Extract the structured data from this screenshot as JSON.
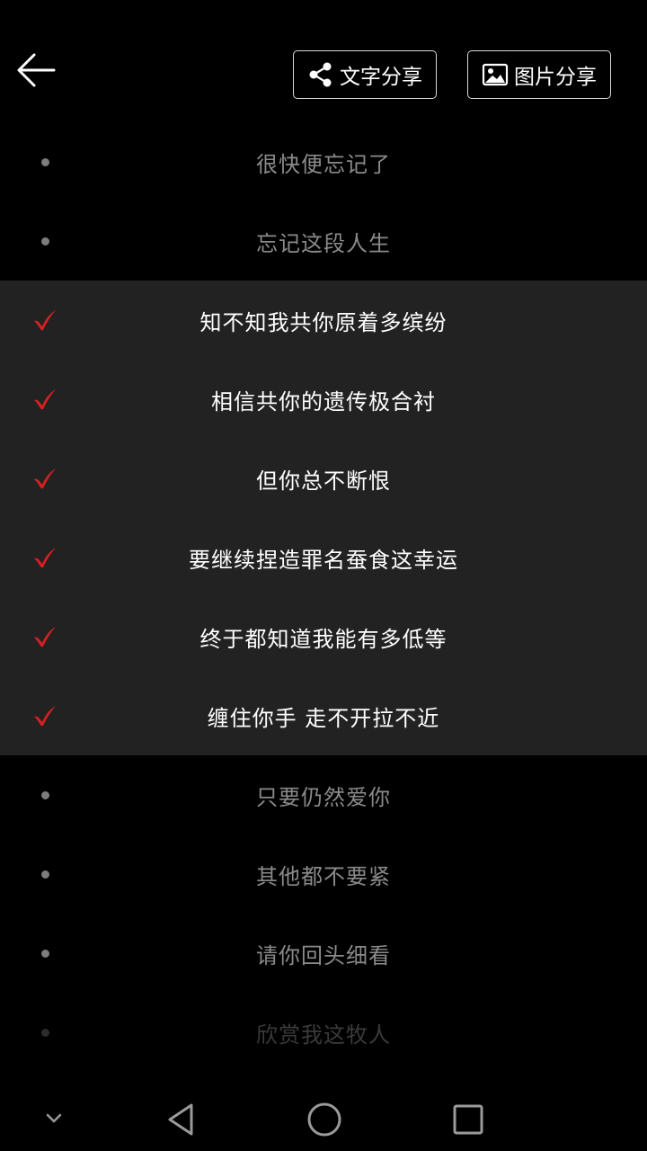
{
  "header": {
    "text_share_label": "文字分享",
    "image_share_label": "图片分享"
  },
  "lyrics": [
    {
      "text": "很快便忘记了",
      "selected": false
    },
    {
      "text": "忘记这段人生",
      "selected": false
    },
    {
      "text": "知不知我共你原着多缤纷",
      "selected": true
    },
    {
      "text": "相信共你的遗传极合衬",
      "selected": true
    },
    {
      "text": "但你总不断恨",
      "selected": true
    },
    {
      "text": "要继续捏造罪名蚕食这幸运",
      "selected": true
    },
    {
      "text": "终于都知道我能有多低等",
      "selected": true
    },
    {
      "text": "缠住你手 走不开拉不近",
      "selected": true
    },
    {
      "text": "只要仍然爱你",
      "selected": false
    },
    {
      "text": "其他都不要紧",
      "selected": false
    },
    {
      "text": "请你回头细看",
      "selected": false
    },
    {
      "text": "欣赏我这牧人",
      "selected": false
    }
  ],
  "colors": {
    "check": "#d42020",
    "selected_bg": "#222222",
    "unselected_text": "#8a8a8a"
  },
  "icons": {
    "back": "arrow-left-icon",
    "share": "share-icon",
    "image": "image-icon",
    "check": "checkmark-icon",
    "dot": "dot-icon"
  }
}
